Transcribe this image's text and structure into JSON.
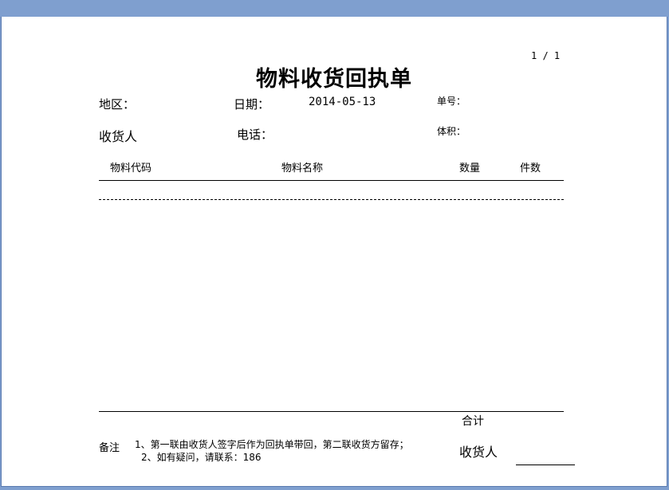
{
  "page_number": "1 / 1",
  "title": "物料收货回执单",
  "header": {
    "region_label": "地区：",
    "date_label": "日期：",
    "date_value": "2014-05-13",
    "doc_no_label": "单号：",
    "receiver_label": "收货人",
    "phone_label": "电话：",
    "volume_label": "体积："
  },
  "table": {
    "columns": [
      "物料代码",
      "物料名称",
      "数量",
      "件数"
    ],
    "rows": []
  },
  "footer": {
    "total_label": "合计",
    "remarks_label": "备注",
    "remarks": [
      "1、第一联由收货人签字后作为回执单带回，第二联收货方留存；",
      "2、如有疑问，请联系：186"
    ],
    "signature_label": "收货人"
  }
}
